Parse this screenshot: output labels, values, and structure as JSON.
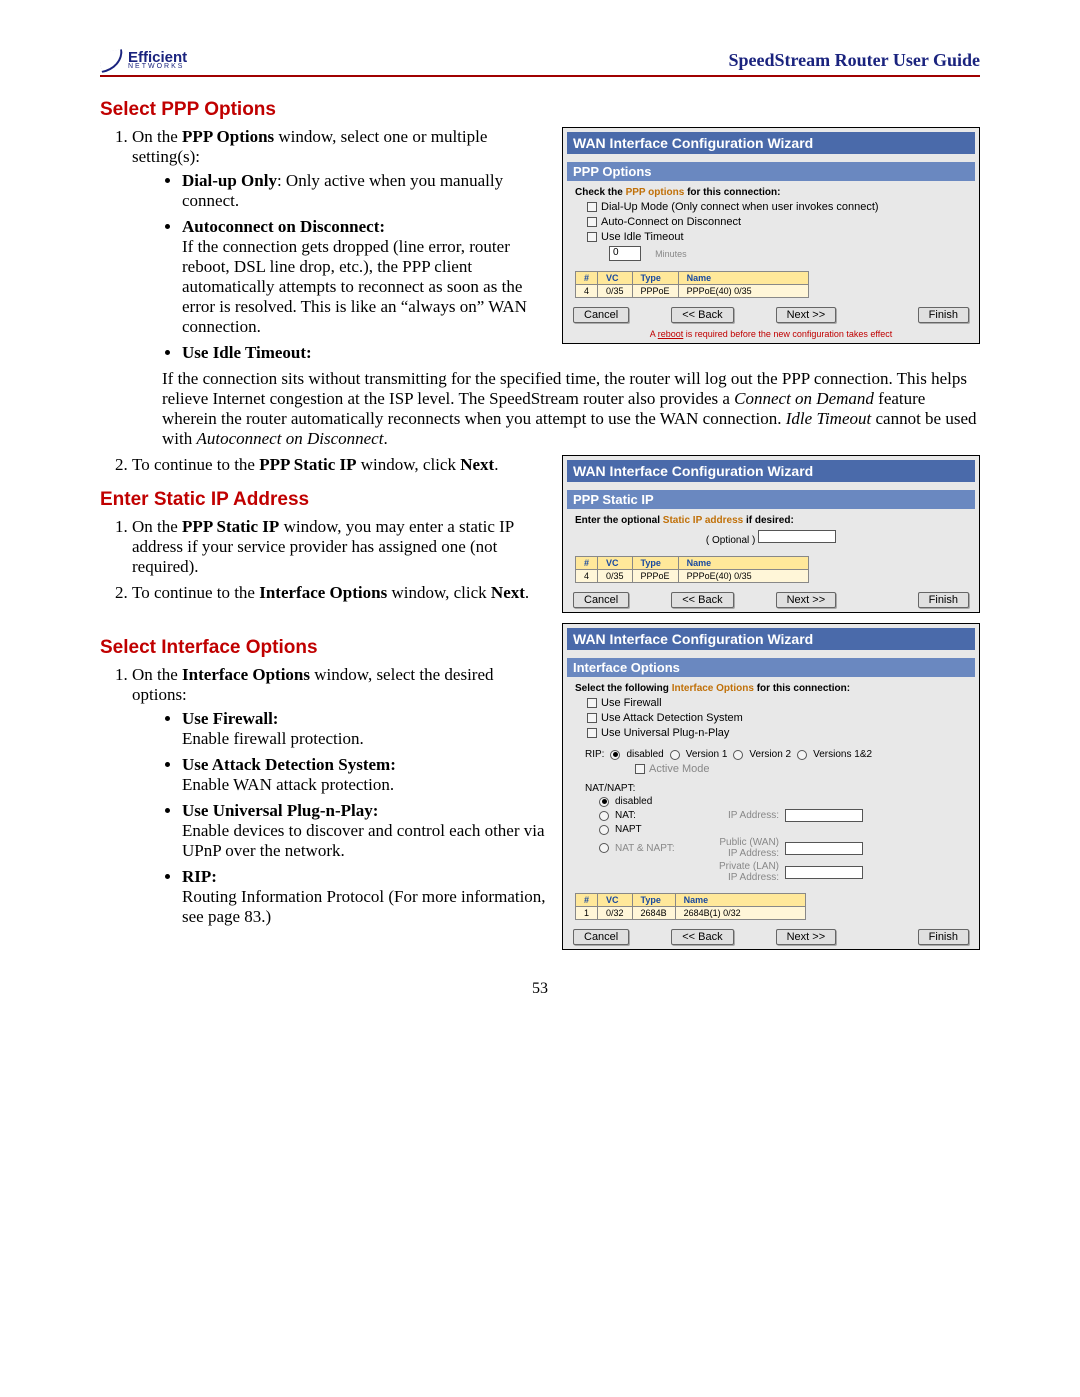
{
  "header": {
    "guide_title": "SpeedStream Router User Guide",
    "logo_name": "Efficient",
    "logo_sub": "NETWORKS"
  },
  "h": {
    "ppp": "Select PPP Options",
    "static": "Enter Static IP Address",
    "ifopt": "Select Interface Options"
  },
  "t": {
    "ppp_step1a": "On the ",
    "ppp_step1b": "PPP Options",
    "ppp_step1c": " window, select one or multiple setting(s):",
    "dial_h": "Dial-up Only",
    "dial_b": ":\nOnly active when you manually connect.",
    "auto_h": "Autoconnect on Disconnect:",
    "auto_b": "If the connection gets dropped (line error, router reboot, DSL line drop, etc.), the PPP client automatically attempts to reconnect as soon as the error is resolved. This is like an “always on” WAN connection.",
    "idle_h": "Use Idle Timeout:",
    "idle_b_a": "If the connection sits without transmitting for the specified time, the router will log out the PPP connection. This helps relieve Internet congestion at the ISP level. The SpeedStream router also provides a ",
    "idle_b_i": "Connect on Demand",
    "idle_b_c": " feature wherein the router automatically reconnects when you attempt to use the WAN connection. ",
    "idle_b_d": "Idle Timeout",
    "idle_b_e": " cannot be used with ",
    "idle_b_f": "Autoconnect on Disconnect",
    "idle_b_g": ".",
    "ppp_step2a": "To continue to the ",
    "ppp_step2b": "PPP Static IP",
    "ppp_step2c": " window, click ",
    "ppp_step2d": "Next",
    "ppp_step2e": ".",
    "static1a": "On the ",
    "static1b": "PPP Static IP",
    "static1c": " window, you may enter a static IP address if your service provider has assigned one (not required).",
    "static2a": "To continue to the ",
    "static2b": "Interface Options",
    "static2c": " window, click ",
    "static2d": "Next",
    "static2e": ".",
    "if1a": "On the ",
    "if1b": "Interface Options",
    "if1c": " window, select the desired options:",
    "fw_h": "Use Firewall:",
    "fw_b": "Enable firewall protection.",
    "ads_h": "Use Attack Detection System:",
    "ads_b": "Enable WAN attack protection.",
    "upnp_h": "Use Universal Plug-n-Play:",
    "upnp_b": "Enable devices to discover and control each other via UPnP over the network.",
    "rip_h": "RIP:",
    "rip_b": "Routing Information Protocol (For more information, see page 83.)"
  },
  "p1": {
    "title": "WAN Interface Configuration Wizard",
    "sub": "PPP Options",
    "instr_a": "Check the ",
    "instr_b": "PPP options",
    "instr_c": " for this connection:",
    "o1": "Dial-Up Mode (Only connect when user invokes connect)",
    "o2": "Auto-Connect on Disconnect",
    "o3": "Use Idle Timeout",
    "min_val": "0",
    "minutes": "Minutes",
    "th": [
      "#",
      "VC",
      "Type",
      "Name"
    ],
    "td": [
      "4",
      "0/35",
      "PPPoE",
      "PPPoE(40) 0/35"
    ],
    "cancel": "Cancel",
    "back": "<< Back",
    "next": "Next >>",
    "finish": "Finish",
    "note_a": "A ",
    "note_b": "reboot",
    "note_c": " is required before the new configuration takes effect"
  },
  "p2": {
    "title": "WAN Interface Configuration Wizard",
    "sub": "PPP Static IP",
    "instr_a": "Enter the optional ",
    "instr_b": "Static IP address",
    "instr_c": " if desired:",
    "opt": "( Optional )",
    "th": [
      "#",
      "VC",
      "Type",
      "Name"
    ],
    "td": [
      "4",
      "0/35",
      "PPPoE",
      "PPPoE(40) 0/35"
    ],
    "cancel": "Cancel",
    "back": "<< Back",
    "next": "Next >>",
    "finish": "Finish"
  },
  "p3": {
    "title": "WAN Interface Configuration Wizard",
    "sub": "Interface Options",
    "instr_a": "Select the following ",
    "instr_b": "Interface Options",
    "instr_c": " for this connection:",
    "o1": "Use Firewall",
    "o2": "Use Attack Detection System",
    "o3": "Use Universal Plug-n-Play",
    "rip_lbl": "RIP:",
    "r_dis": "disabled",
    "r_v1": "Version 1",
    "r_v2": "Version 2",
    "r_v12": "Versions 1&2",
    "active": "Active Mode",
    "nat_lbl": "NAT/NAPT:",
    "n_dis": "disabled",
    "n_nat": "NAT:",
    "n_napt": "NAPT",
    "n_both": "NAT & NAPT:",
    "ip1": "IP Address:",
    "ip2a": "Public (WAN)",
    "ip2b": "IP Address:",
    "ip3a": "Private (LAN)",
    "ip3b": "IP Address:",
    "th": [
      "#",
      "VC",
      "Type",
      "Name"
    ],
    "td": [
      "1",
      "0/32",
      "2684B",
      "2684B(1) 0/32"
    ],
    "cancel": "Cancel",
    "back": "<< Back",
    "next": "Next >>",
    "finish": "Finish"
  },
  "page": "53"
}
